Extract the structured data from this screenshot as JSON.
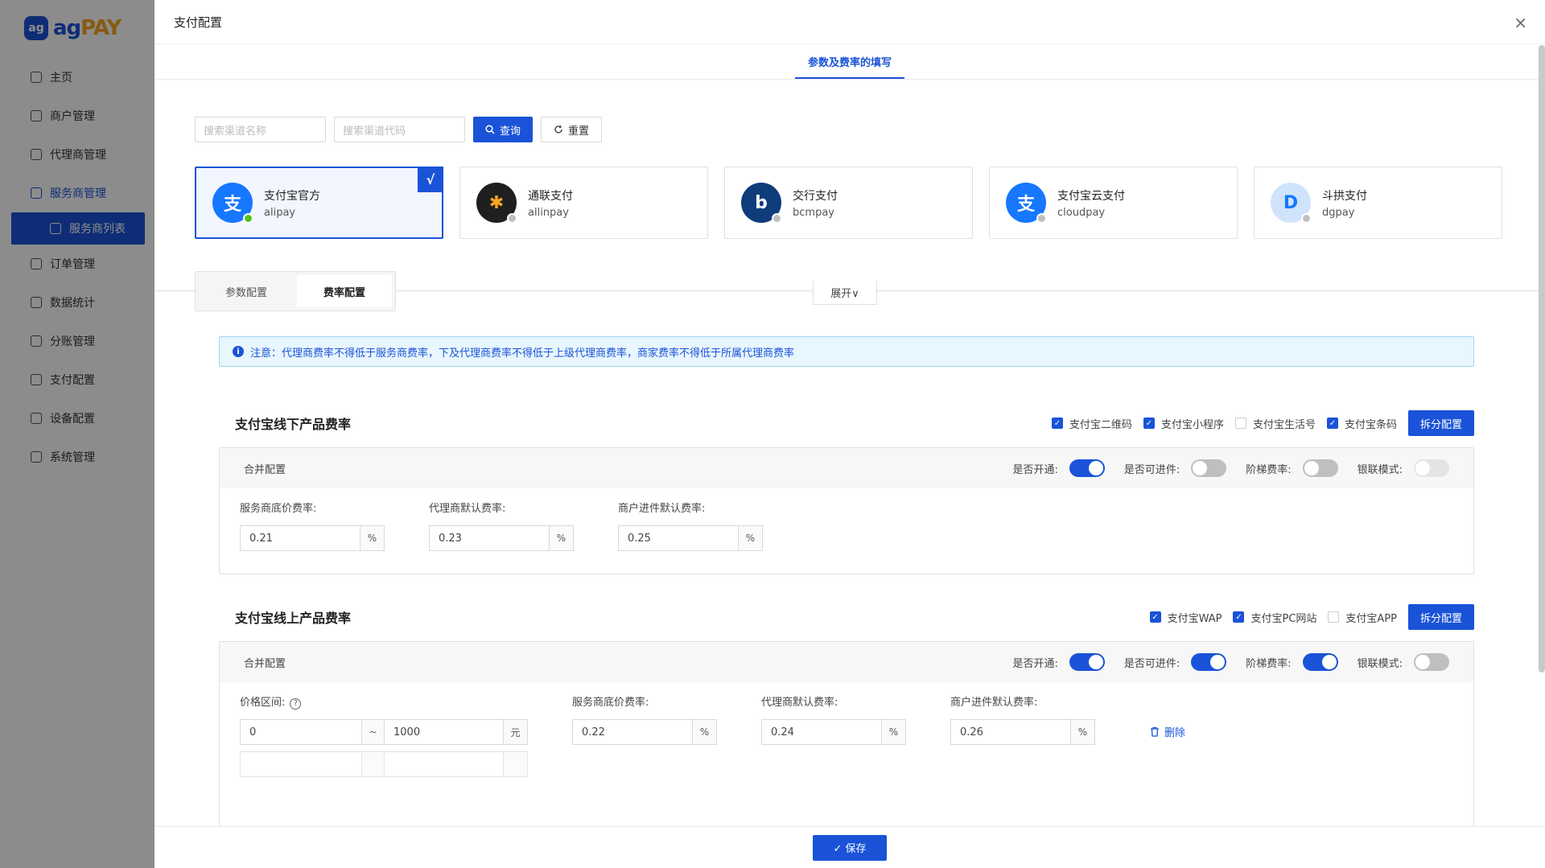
{
  "sidebar": {
    "logo_mark": "ag",
    "logo_text_1": "ag",
    "logo_text_2": "PAY",
    "items": [
      {
        "label": "主页"
      },
      {
        "label": "商户管理"
      },
      {
        "label": "代理商管理"
      },
      {
        "label": "服务商管理"
      },
      {
        "label": "服务商列表"
      },
      {
        "label": "订单管理"
      },
      {
        "label": "数据统计"
      },
      {
        "label": "分账管理"
      },
      {
        "label": "支付配置"
      },
      {
        "label": "设备配置"
      },
      {
        "label": "系统管理"
      }
    ]
  },
  "drawer": {
    "title": "支付配置",
    "close": "×",
    "top_tab": "参数及费率的填写"
  },
  "search": {
    "name_placeholder": "搜索渠道名称",
    "code_placeholder": "搜索渠道代码",
    "query": "查询",
    "reset": "重置"
  },
  "channels": [
    {
      "name": "支付宝官方",
      "code": "alipay",
      "icon_text": "支",
      "color": "#1677ff",
      "status_color": "#52c41a"
    },
    {
      "name": "通联支付",
      "code": "allinpay",
      "icon_text": "✱",
      "color": "#1f1f1f",
      "status_color": "#bfbfbf"
    },
    {
      "name": "交行支付",
      "code": "bcmpay",
      "icon_text": "b",
      "color": "#0f3c7a",
      "status_color": "#bfbfbf"
    },
    {
      "name": "支付宝云支付",
      "code": "cloudpay",
      "icon_text": "支",
      "color": "#1677ff",
      "status_color": "#bfbfbf"
    },
    {
      "name": "斗拱支付",
      "code": "dgpay",
      "icon_text": "D",
      "color": "#cfe3fb",
      "status_color": "#bfbfbf"
    }
  ],
  "selected_check": "√",
  "subtabs": {
    "param": "参数配置",
    "rate": "费率配置",
    "expand": "展开∨"
  },
  "notice": {
    "icon": "i",
    "text": "注意：代理商费率不得低于服务商费率，下及代理商费率不得低于上级代理商费率，商家费率不得低于所属代理商费率"
  },
  "offline": {
    "title": "支付宝线下产品费率",
    "checkboxes": [
      {
        "label": "支付宝二维码",
        "checked": true
      },
      {
        "label": "支付宝小程序",
        "checked": true
      },
      {
        "label": "支付宝生活号",
        "checked": false
      },
      {
        "label": "支付宝条码",
        "checked": true
      }
    ],
    "split_btn": "拆分配置",
    "merge_label": "合并配置",
    "switches": [
      {
        "label": "是否开通:",
        "state": "on"
      },
      {
        "label": "是否可进件:",
        "state": "off"
      },
      {
        "label": "阶梯费率:",
        "state": "off"
      },
      {
        "label": "银联模式:",
        "state": "disabled"
      }
    ],
    "fields": [
      {
        "label": "服务商底价费率:",
        "value": "0.21",
        "unit": "%"
      },
      {
        "label": "代理商默认费率:",
        "value": "0.23",
        "unit": "%"
      },
      {
        "label": "商户进件默认费率:",
        "value": "0.25",
        "unit": "%"
      }
    ]
  },
  "online": {
    "title": "支付宝线上产品费率",
    "checkboxes": [
      {
        "label": "支付宝WAP",
        "checked": true
      },
      {
        "label": "支付宝PC网站",
        "checked": true
      },
      {
        "label": "支付宝APP",
        "checked": false
      }
    ],
    "split_btn": "拆分配置",
    "merge_label": "合并配置",
    "switches": [
      {
        "label": "是否开通:",
        "state": "on"
      },
      {
        "label": "是否可进件:",
        "state": "on"
      },
      {
        "label": "阶梯费率:",
        "state": "on"
      },
      {
        "label": "银联模式:",
        "state": "off"
      }
    ],
    "price_range_label": "价格区间:",
    "help": "?",
    "range_from": "0",
    "range_sep": "~",
    "range_to": "1000",
    "range_unit": "元",
    "fields": [
      {
        "label": "服务商底价费率:",
        "value": "0.22",
        "unit": "%"
      },
      {
        "label": "代理商默认费率:",
        "value": "0.24",
        "unit": "%"
      },
      {
        "label": "商户进件默认费率:",
        "value": "0.26",
        "unit": "%"
      }
    ],
    "delete": "删除"
  },
  "footer": {
    "save": "✓ 保存"
  }
}
